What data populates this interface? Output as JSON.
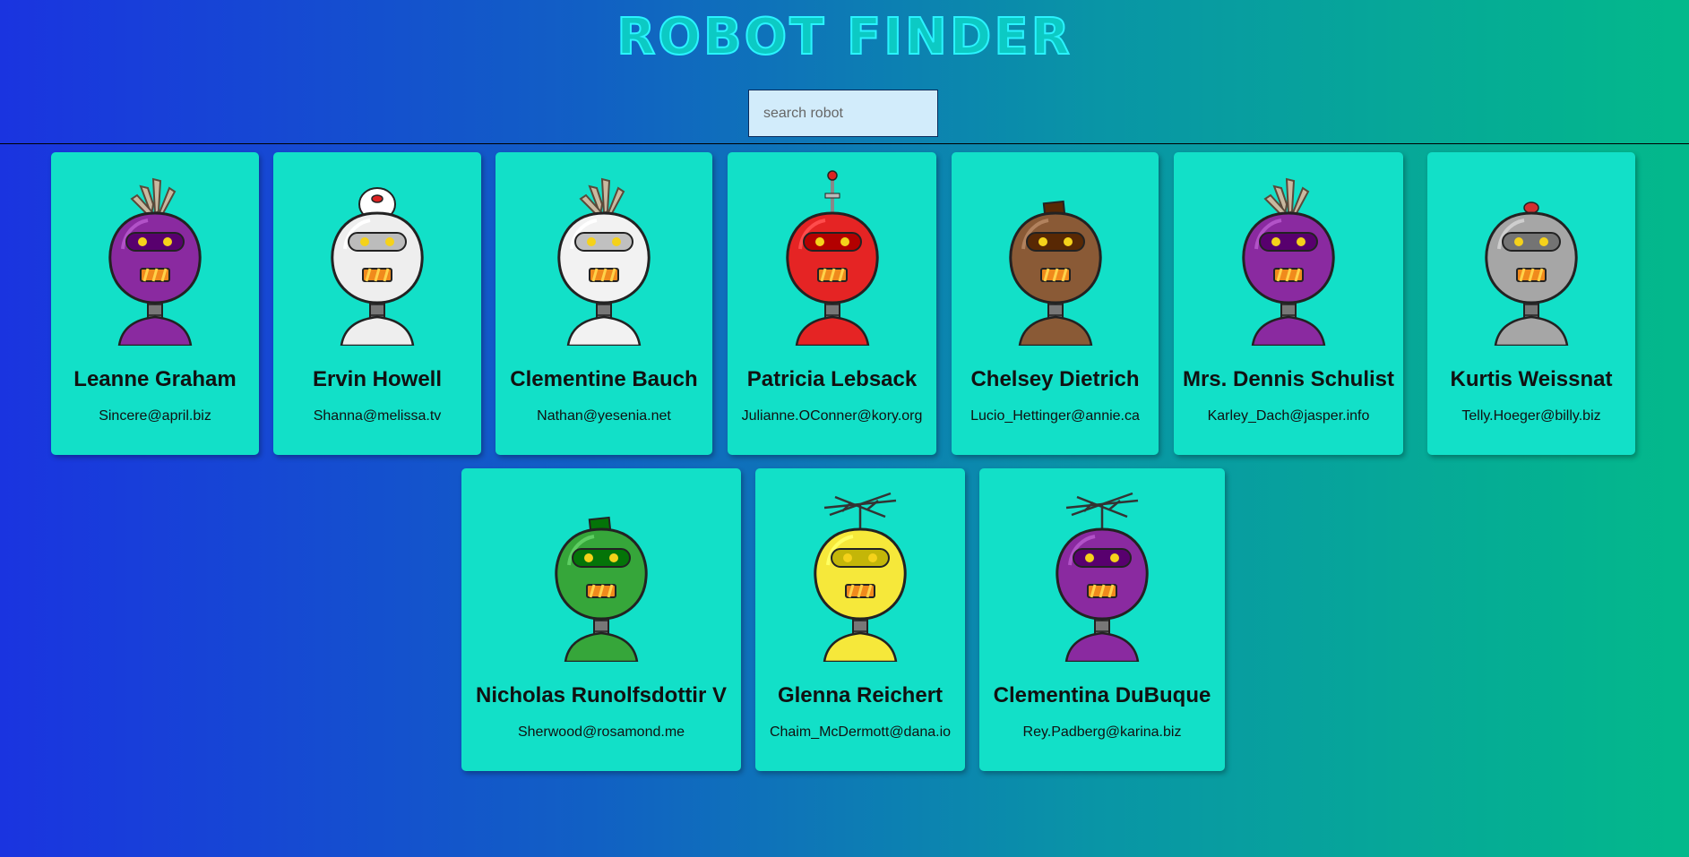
{
  "app": {
    "title": "ROBOT FINDER"
  },
  "search": {
    "placeholder": "search robot",
    "value": ""
  },
  "robots": [
    {
      "name": "Leanne Graham",
      "email": "Sincere@april.biz",
      "color": "#8a2aa0",
      "head": "tuft"
    },
    {
      "name": "Ervin Howell",
      "email": "Shanna@melissa.tv",
      "color": "#eeeeee",
      "head": "dome"
    },
    {
      "name": "Clementine Bauch",
      "email": "Nathan@yesenia.net",
      "color": "#f2f2f2",
      "head": "tuft"
    },
    {
      "name": "Patricia Lebsack",
      "email": "Julianne.OConner@kory.org",
      "color": "#e52424",
      "head": "antenna"
    },
    {
      "name": "Chelsey Dietrich",
      "email": "Lucio_Hettinger@annie.ca",
      "color": "#8a5a36",
      "head": "block"
    },
    {
      "name": "Mrs. Dennis Schulist",
      "email": "Karley_Dach@jasper.info",
      "color": "#8a2aa0",
      "head": "tuft"
    },
    {
      "name": "Kurtis Weissnat",
      "email": "Telly.Hoeger@billy.biz",
      "color": "#a6a6a6",
      "head": "button"
    },
    {
      "name": "Nicholas Runolfsdottir V",
      "email": "Sherwood@rosamond.me",
      "color": "#36a63a",
      "head": "block"
    },
    {
      "name": "Glenna Reichert",
      "email": "Chaim_McDermott@dana.io",
      "color": "#f6e83a",
      "head": "tv"
    },
    {
      "name": "Clementina DuBuque",
      "email": "Rey.Padberg@karina.biz",
      "color": "#8a2aa0",
      "head": "tv"
    }
  ]
}
